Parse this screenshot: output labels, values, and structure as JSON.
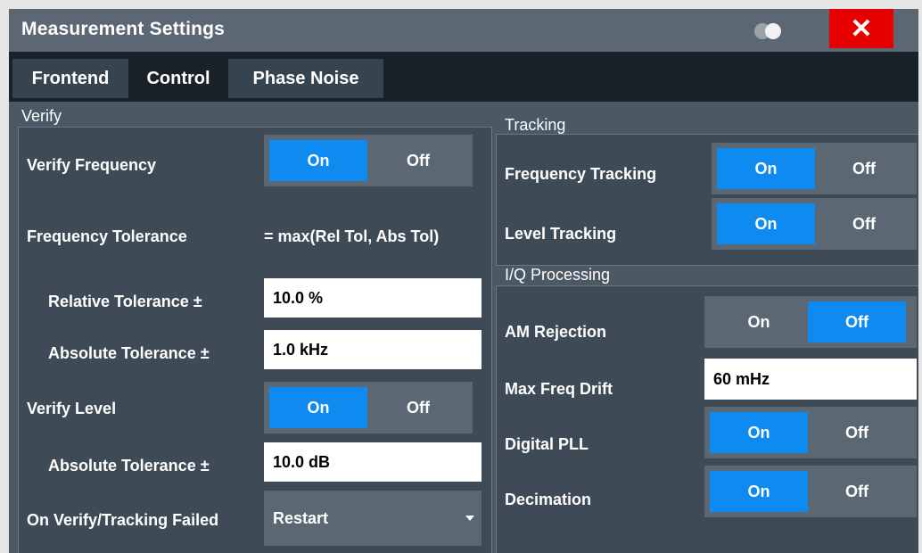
{
  "dialog": {
    "title": "Measurement Settings",
    "close_glyph": "✕",
    "theme_icon": "theme-toggle-icon",
    "close_color": "#e60000",
    "accent_color": "#0e8af0"
  },
  "tabs": [
    {
      "label": "Frontend",
      "active": false
    },
    {
      "label": "Control",
      "active": true
    },
    {
      "label": "Phase Noise",
      "active": false
    }
  ],
  "verify": {
    "title": "Verify",
    "verify_frequency": {
      "label": "Verify Frequency",
      "on": "On",
      "off": "Off",
      "selected": "On"
    },
    "frequency_tolerance": {
      "label": "Frequency Tolerance",
      "value": "= max(Rel Tol, Abs Tol)"
    },
    "relative_tolerance": {
      "label": "Relative Tolerance ±",
      "value": "10.0 %"
    },
    "absolute_tolerance_freq": {
      "label": "Absolute Tolerance ±",
      "value": "1.0 kHz"
    },
    "verify_level": {
      "label": "Verify Level",
      "on": "On",
      "off": "Off",
      "selected": "On"
    },
    "absolute_tolerance_level": {
      "label": "Absolute Tolerance ±",
      "value": "10.0 dB"
    },
    "on_failed": {
      "label": "On Verify/Tracking Failed",
      "value": "Restart"
    }
  },
  "tracking": {
    "title": "Tracking",
    "frequency_tracking": {
      "label": "Frequency Tracking",
      "on": "On",
      "off": "Off",
      "selected": "On"
    },
    "level_tracking": {
      "label": "Level Tracking",
      "on": "On",
      "off": "Off",
      "selected": "On"
    }
  },
  "iq": {
    "title": "I/Q Processing",
    "am_rejection": {
      "label": "AM Rejection",
      "on": "On",
      "off": "Off",
      "selected": "Off"
    },
    "max_freq_drift": {
      "label": "Max Freq Drift",
      "value": "60 mHz"
    },
    "digital_pll": {
      "label": "Digital PLL",
      "on": "On",
      "off": "Off",
      "selected": "On"
    },
    "decimation": {
      "label": "Decimation",
      "on": "On",
      "off": "Off",
      "selected": "On"
    }
  }
}
